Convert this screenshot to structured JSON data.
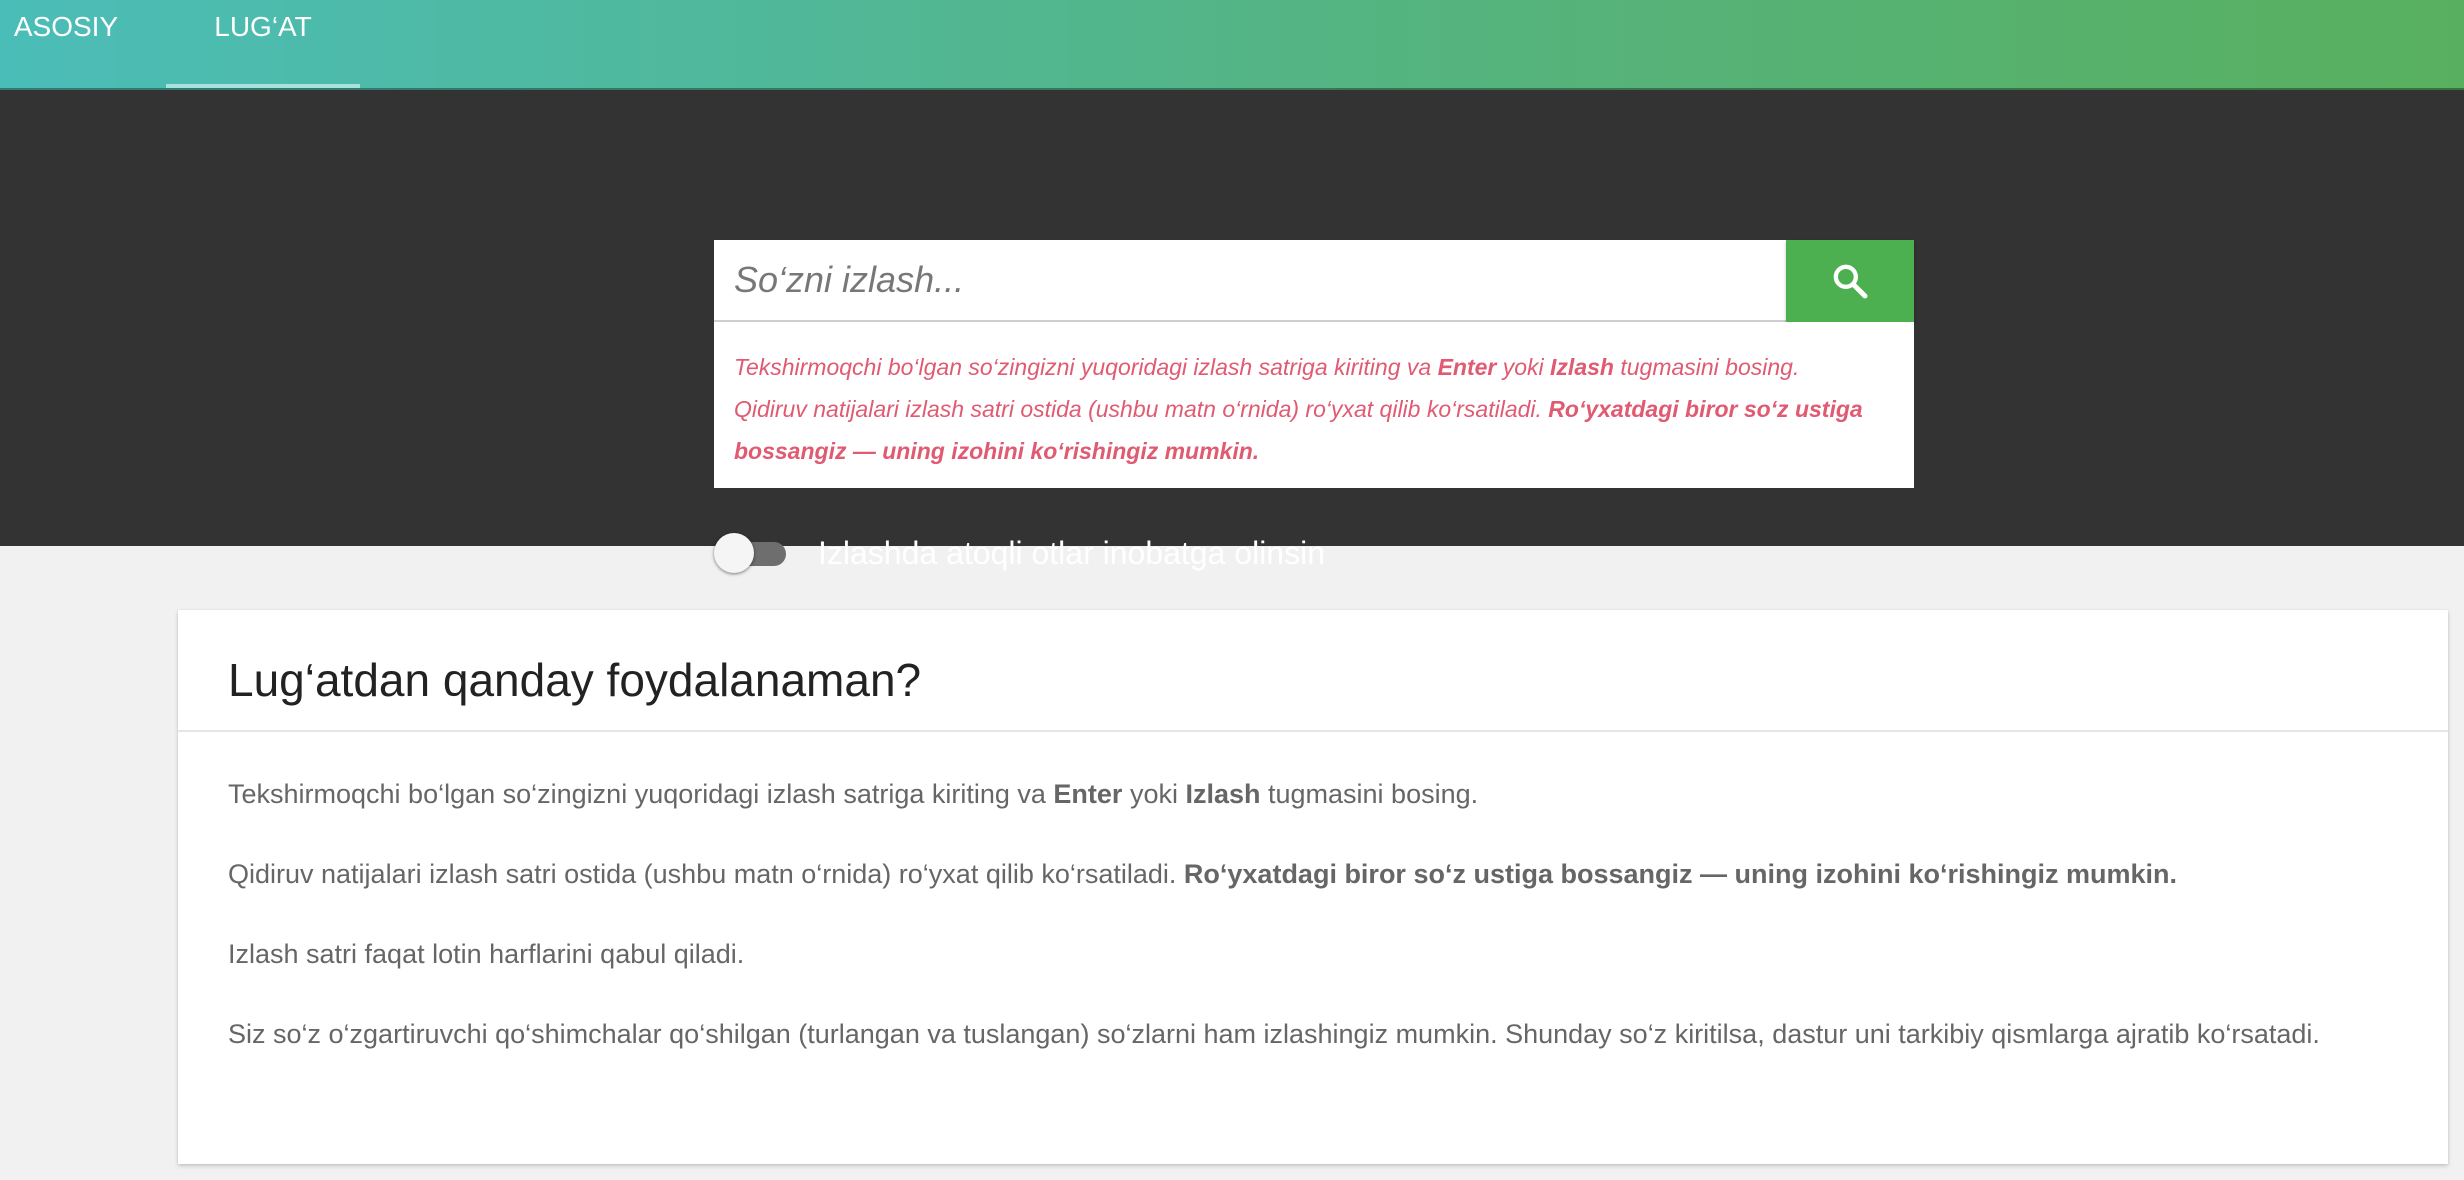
{
  "nav": {
    "items": [
      {
        "label": "ASOSIY"
      },
      {
        "label": "LUG‘AT"
      }
    ]
  },
  "search": {
    "placeholder": "So‘zni izlash...",
    "button_icon": "search-icon"
  },
  "hint": {
    "l1_a": "Tekshirmoqchi bo‘lgan so‘zingizni yuqoridagi izlash satriga kiriting va ",
    "l1_b": "Enter",
    "l1_c": " yoki ",
    "l1_d": "Izlash",
    "l1_e": " tugmasini bosing.",
    "l2_a": "Qidiruv natijalari izlash satri ostida (ushbu matn o‘rnida) ro‘yxat qilib ko‘rsatiladi. ",
    "l2_b": "Ro‘yxatdagi biror so‘z ustiga bossangiz — uning izohini ko‘rishingiz mumkin."
  },
  "toggle": {
    "label": "Izlashda atoqli otlar inobatga olinsin",
    "checked": false
  },
  "card": {
    "title": "Lug‘atdan qanday foydalanaman?",
    "p1_a": "Tekshirmoqchi bo‘lgan so‘zingizni yuqoridagi izlash satriga kiriting va ",
    "p1_b": "Enter",
    "p1_c": " yoki ",
    "p1_d": "Izlash",
    "p1_e": " tugmasini bosing.",
    "p2_a": "Qidiruv natijalari izlash satri ostida (ushbu matn o‘rnida) ro‘yxat qilib ko‘rsatiladi. ",
    "p2_b": "Ro‘yxatdagi biror so‘z ustiga bossangiz — uning izohini ko‘rishingiz mumkin.",
    "p3": "Izlash satri faqat lotin harflarini qabul qiladi.",
    "p4": "Siz so‘z o‘zgartiruvchi qo‘shimchalar qo‘shilgan (turlangan va tuslangan) so‘zlarni ham izlashingiz mumkin. Shunday so‘z kiritilsa, dastur uni tarkibiy qismlarga ajratib ko‘rsatadi."
  },
  "colors": {
    "nav_gradient_start": "#4bbdb8",
    "nav_gradient_end": "#58b05f",
    "hero_bg": "#333333",
    "search_button": "#4caf50",
    "hint_text": "#e05a72",
    "page_bg": "#f1f1f1"
  }
}
